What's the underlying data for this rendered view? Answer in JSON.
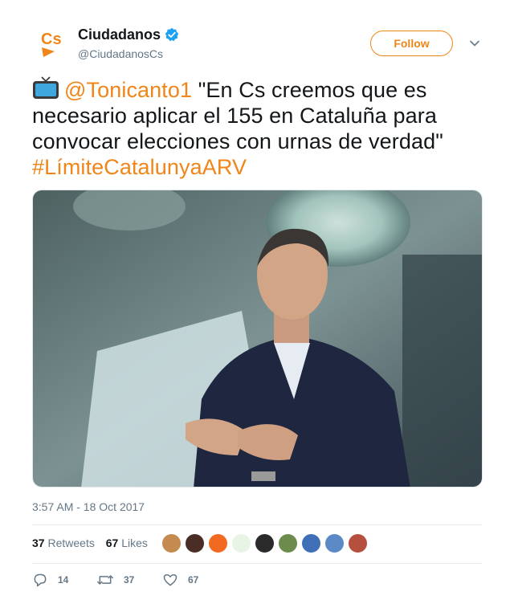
{
  "user": {
    "display_name": "Ciudadanos",
    "handle": "@CiudadanosCs",
    "avatar_text": "Cs",
    "brand_color": "#f08519"
  },
  "header": {
    "follow_label": "Follow"
  },
  "tweet": {
    "mention": "@Tonicanto1",
    "quote_line": "\"En Cs creemos que es necesario aplicar el 155 en Cataluña para convocar elecciones con urnas de verdad\"",
    "hashtag": "#LímiteCatalunyaARV",
    "emoji_icon": "tv-icon"
  },
  "meta": {
    "timestamp": "3:57 AM - 18 Oct 2017",
    "retweets_count": "37",
    "retweets_label": "Retweets",
    "likes_count": "67",
    "likes_label": "Likes"
  },
  "actions": {
    "reply_count": "14",
    "retweet_count": "37",
    "like_count": "67"
  },
  "likers": [
    {
      "name": "liker-avatar-1",
      "color": "#c58a4f"
    },
    {
      "name": "liker-avatar-2",
      "color": "#4a2e26"
    },
    {
      "name": "liker-avatar-3",
      "color": "#f26a21"
    },
    {
      "name": "liker-avatar-4",
      "color": "#e8f4e4"
    },
    {
      "name": "liker-avatar-5",
      "color": "#2b2b2b"
    },
    {
      "name": "liker-avatar-6",
      "color": "#6e8b4e"
    },
    {
      "name": "liker-avatar-7",
      "color": "#3f6fb6"
    },
    {
      "name": "liker-avatar-8",
      "color": "#5b8ac7"
    },
    {
      "name": "liker-avatar-9",
      "color": "#b5503f"
    }
  ]
}
